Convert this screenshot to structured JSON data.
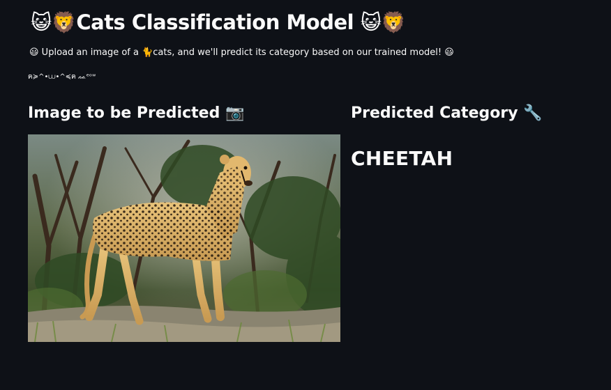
{
  "app": {
    "title": "😺🦁Cats Classification Model 😺🦁",
    "subtitle": "😃 Upload an image of a 🐈cats, and we'll predict its category based on our trained model! 😃",
    "kaomoji": "ฅ≽^•⩊•^≼ฅ ᨐᵉᵒʷ"
  },
  "left_column": {
    "heading": "Image to be Predicted 📷",
    "image_alt": "cheetah"
  },
  "right_column": {
    "heading": "Predicted Category 🔧",
    "prediction": "CHEETAH"
  },
  "colors": {
    "background": "#0e1117",
    "text": "#fafafa"
  }
}
